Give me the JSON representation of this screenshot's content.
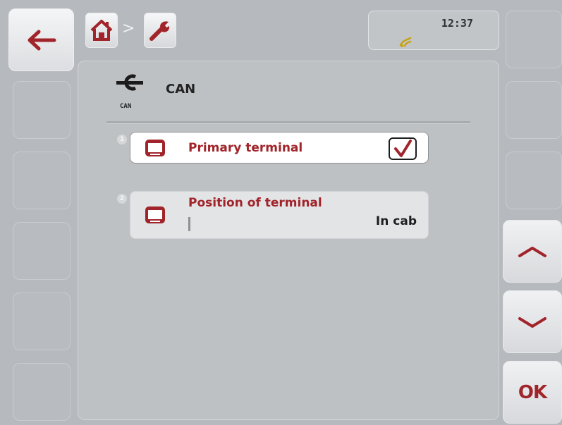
{
  "header": {
    "time": "12:37",
    "breadcrumb_separator": ">",
    "breadcrumb": [
      "home-icon",
      "wrench-icon"
    ]
  },
  "panel": {
    "title": "CAN",
    "icon_caption": "CAN"
  },
  "parameters": [
    {
      "index": "1",
      "label": "Primary terminal",
      "type": "checkbox",
      "checked": true,
      "icon": "terminal-icon"
    },
    {
      "index": "2",
      "label": "Position of terminal",
      "value": "In cab",
      "icon": "terminal-icon"
    }
  ],
  "softkeys": {
    "back": "arrow-left-icon",
    "scroll_up": "chevron-up-icon",
    "scroll_down": "chevron-down-icon",
    "ok_label": "OK"
  },
  "colors": {
    "accent": "#a1242a",
    "background": "#b6b9bd"
  }
}
